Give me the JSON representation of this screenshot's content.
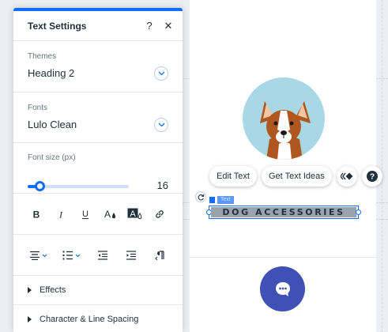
{
  "panel": {
    "title": "Text Settings",
    "help_label": "?",
    "close_label": "✕",
    "themes": {
      "label": "Themes",
      "value": "Heading 2"
    },
    "fonts": {
      "label": "Fonts",
      "value": "Lulo Clean"
    },
    "font_size": {
      "label": "Font size (px)",
      "value": "16",
      "slider_fraction": 0.12
    },
    "format_tools": [
      "bold-icon",
      "italic-icon",
      "underline-icon",
      "text-color-icon",
      "highlight-icon",
      "link-icon"
    ],
    "paragraph_tools": [
      "align-icon",
      "bullets-icon",
      "decrease-indent-icon",
      "increase-indent-icon",
      "text-direction-icon"
    ],
    "sections": [
      {
        "label": "Effects"
      },
      {
        "label": "Character & Line Spacing"
      }
    ]
  },
  "canvas": {
    "toolbar": {
      "edit_text": "Edit Text",
      "get_text_ideas": "Get Text Ideas"
    },
    "element_tag": "Text",
    "heading_text": "DOG ACCESSORIES",
    "chat_icon": "chat-bubble-icon"
  },
  "colors": {
    "accent": "#116dff",
    "chat_button": "#3f51b5",
    "image_bg": "#a8d8e6",
    "text_highlight": "#9aa3ad"
  }
}
